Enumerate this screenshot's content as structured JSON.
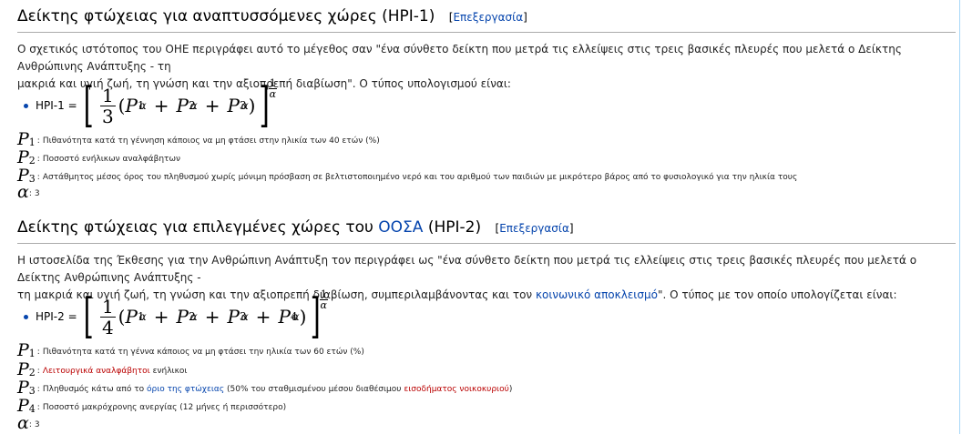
{
  "s1": {
    "title": "Δείκτης φτώχειας για αναπτυσσόμενες χώρες (HPI-1)",
    "edit": "Επεξεργασία",
    "para_a": "Ο σχετικός ιστότοπος του ΟΗΕ περιγράφει αυτό το μέγεθος σαν \"ένα σύνθετο δείκτη που μετρά τις ελλείψεις στις τρεις βασικές πλευρές που μελετά ο Δείκτης Ανθρώπινης Ανάπτυξης - τη",
    "para_b": "μακριά και υγιή ζωή, τη γνώση και την αξιοπρεπή διαβίωση\". Ο τύπος υπολογισμού είναι:",
    "formula_label": "HPI-1 =",
    "frac_num": "1",
    "frac_den": "3",
    "defs": [
      {
        "sym": "P",
        "sub": "1",
        "text": "Πιθανότητα κατά τη γέννηση κάποιος να μη φτάσει στην ηλικία των 40 ετών (%)"
      },
      {
        "sym": "P",
        "sub": "2",
        "text": "Ποσοστό ενήλικων αναλφάβητων"
      },
      {
        "sym": "P",
        "sub": "3",
        "text": "Αστάθμητος μέσος όρος του πληθυσμού χωρίς μόνιμη πρόσβαση σε βελτιστοποιημένο νερό και του αριθμού των παιδιών με μικρότερο βάρος από το φυσιολογικό για την ηλικία τους"
      },
      {
        "sym": "α",
        "sub": "",
        "text": "3"
      }
    ]
  },
  "s2": {
    "title_a": "Δείκτης φτώχειας για επιλεγμένες χώρες του ",
    "title_link": "ΟΟΣΑ",
    "title_b": " (HPI-2)",
    "edit": "Επεξεργασία",
    "para_a": "Η ιστοσελίδα της Έκθεσης για την Ανθρώπινη Ανάπτυξη τον περιγράφει ως \"ένα σύνθετο δείκτη που μετρά τις ελλείψεις στις τρεις βασικές πλευρές που μελετά ο Δείκτης Ανθρώπινης Ανάπτυξης -",
    "para_b": "τη μακριά και υγιή ζωή, τη γνώση και την αξιοπρεπή διαβίωση, συμπεριλαμβάνοντας και τον ",
    "para_link": "κοινωνικό αποκλεισμό",
    "para_c": "\". Ο τύπος με τον οποίο υπολογίζεται είναι:",
    "formula_label": "HPI-2 =",
    "frac_num": "1",
    "frac_den": "4",
    "def1": "Πιθανότητα κατά τη γέννα κάποιος να μη φτάσει την ηλικία των 60 ετών (%)",
    "def2_link": "Λειτουργικά αναλφάβητοι",
    "def2_rest": " ενήλικοι",
    "def3_a": "Πληθυσμός κάτω από το ",
    "def3_link1": "όριο της φτώχειας",
    "def3_b": " (50% του σταθμισμένου μέσου διαθέσιμου ",
    "def3_link2": "εισοδήματος νοικοκυριού",
    "def3_c": ")",
    "def4": "Ποσοστό μακρόχρονης ανεργίας (12 μήνες ή περισσότερο)",
    "alpha": "3"
  },
  "math": {
    "var": "P",
    "alpha": "α",
    "plus": "+",
    "lbracket": "[",
    "rbracket": "]",
    "lparen": "(",
    "rparen": ")",
    "exp_num": "1",
    "exp_den": "α"
  },
  "colors": {
    "link": "#0645ad",
    "redlink": "#ba0000",
    "rule": "#aaaaaa"
  }
}
